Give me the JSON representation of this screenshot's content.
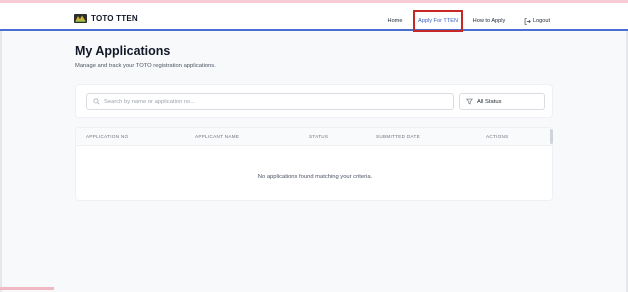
{
  "brand": {
    "name": "TOTO TTEN",
    "logo_icon": "flag-logo-icon"
  },
  "nav": {
    "items": [
      {
        "label": "Home",
        "active": false
      },
      {
        "label": "Apply For TTEN",
        "active": true
      },
      {
        "label": "How to Apply",
        "active": false
      }
    ],
    "logout_label": "Logout",
    "logout_icon": "logout-icon"
  },
  "page": {
    "title": "My Applications",
    "subtitle": "Manage and track your TOTO registration applications."
  },
  "filters": {
    "search_placeholder": "Search by name or application no...",
    "search_value": "",
    "status_selected": "All Status"
  },
  "table": {
    "columns": [
      "APPLICATION NO",
      "APPLICANT NAME",
      "STATUS",
      "SUBMITTED DATE",
      "ACTIONS"
    ],
    "rows": [],
    "empty_message": "No applications found matching your criteria."
  },
  "colors": {
    "accent": "#3b63c4",
    "nav_border": "#4a6fd0",
    "highlight": "#c62828"
  }
}
